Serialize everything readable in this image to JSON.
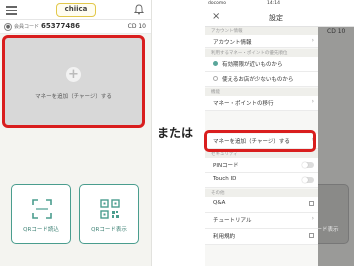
{
  "connector_text": "または",
  "left_screen": {
    "logo_text": "chiica",
    "member_label": "会員コード",
    "member_code": "65377486",
    "cd_value": "CD 10",
    "add_money_label": "マネーを追加（チャージ）する",
    "qr_read_label": "QRコード読込",
    "qr_show_label": "QRコード表示"
  },
  "right_screen": {
    "status": {
      "carrier": "docomo",
      "time": "14:14"
    },
    "nav_title": "設定",
    "close_icon": "×",
    "background": {
      "cd_value": "CD 10",
      "qr_partial_label": "コード表示"
    },
    "sections": [
      {
        "header": "アカウント情報",
        "rows": [
          {
            "label": "アカウント情報",
            "type": "chevron"
          }
        ]
      },
      {
        "header": "利用するマネー・ポイントの優先順位",
        "rows": [
          {
            "label": "有効期限が近いものから",
            "type": "radio",
            "selected": true
          },
          {
            "label": "使えるお店が少ないものから",
            "type": "radio",
            "selected": false
          }
        ]
      },
      {
        "header": "機能",
        "rows": [
          {
            "label": "マネー・ポイントの移行",
            "type": "chevron"
          },
          {
            "label": "マネーを追加（チャージ）する",
            "type": "chevron"
          }
        ]
      },
      {
        "header": "セキュリティ",
        "rows": [
          {
            "label": "PINコード",
            "type": "toggle"
          },
          {
            "label": "Touch ID",
            "type": "toggle"
          }
        ]
      },
      {
        "header": "その他",
        "rows": [
          {
            "label": "Q&A",
            "type": "external"
          },
          {
            "label": "チュートリアル",
            "type": "chevron"
          },
          {
            "label": "利用規約",
            "type": "external"
          }
        ]
      }
    ]
  },
  "colors": {
    "highlight": "#d91e1e",
    "accent": "#4a9d8e"
  }
}
